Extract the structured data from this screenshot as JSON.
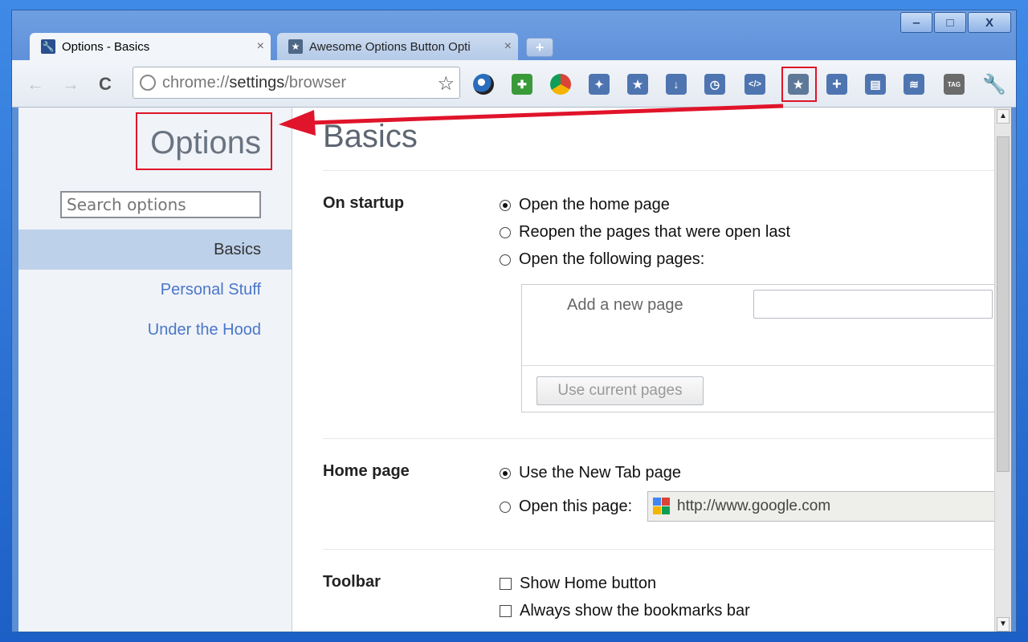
{
  "window": {
    "minimize_label": "‒",
    "restore_label": "□",
    "close_label": "X"
  },
  "tabs": [
    {
      "title": "Options - Basics",
      "close_label": "×"
    },
    {
      "title": "Awesome Options Button Opti",
      "close_label": "×"
    }
  ],
  "toolbar": {
    "back_label": "←",
    "forward_label": "→",
    "reload_label": "C",
    "url_scheme": "chrome://",
    "url_host": "settings",
    "url_path": "/browser",
    "star_label": "☆",
    "wrench_label": "🔧"
  },
  "sidebar": {
    "title": "Options",
    "search_placeholder": "Search options",
    "items": [
      {
        "label": "Basics",
        "selected": true
      },
      {
        "label": "Personal Stuff",
        "selected": false
      },
      {
        "label": "Under the Hood",
        "selected": false
      }
    ]
  },
  "main": {
    "title": "Basics",
    "startup": {
      "label": "On startup",
      "options": [
        "Open the home page",
        "Reopen the pages that were open last",
        "Open the following pages:"
      ],
      "selected": 0,
      "add_page_label": "Add a new page",
      "use_current_label": "Use current pages"
    },
    "homepage": {
      "label": "Home page",
      "options": [
        "Use the New Tab page",
        "Open this page:"
      ],
      "selected": 0,
      "url_value": "http://www.google.com"
    },
    "toolbar_section": {
      "label": "Toolbar",
      "options": [
        "Show Home button",
        "Always show the bookmarks bar"
      ]
    }
  },
  "colors": {
    "highlight": "#e0142a",
    "link": "#4a77c8",
    "selected_nav": "#bed1ea"
  }
}
